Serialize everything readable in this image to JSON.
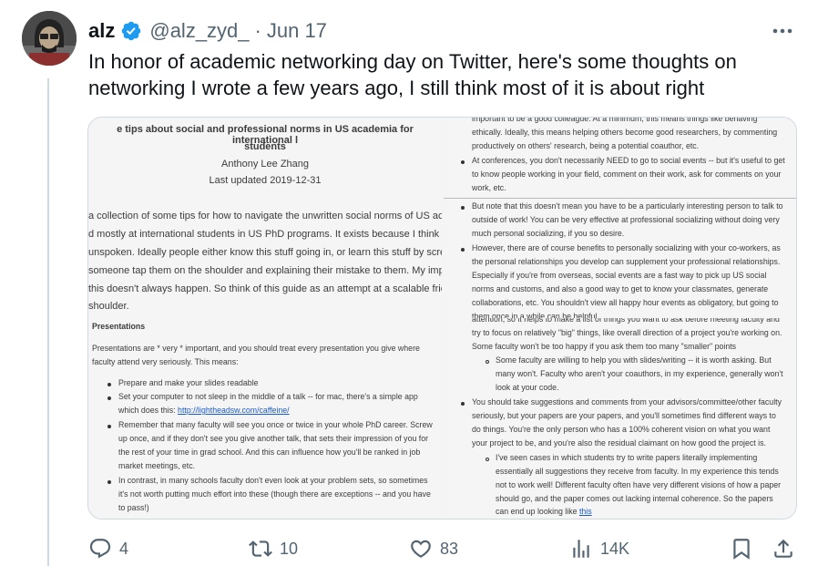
{
  "tweet": {
    "name": "alz",
    "handle": "@alz_zyd_",
    "separator": "·",
    "date": "Jun 17",
    "text": "In honor of academic networking day on Twitter, here's some thoughts on networking I wrote a few years ago, I still think most of it is about right"
  },
  "actions": {
    "replies": "4",
    "retweets": "10",
    "likes": "83",
    "views": "14K"
  },
  "doc": {
    "title_1": "e tips about social and professional norms in US academia for international l",
    "title_2": "students",
    "author": "Anthony Lee Zhang",
    "updated": "Last updated 2019-12-31",
    "intro": [
      "a collection of some tips for how to navigate the unwritten social norms of US acad",
      "d mostly at international students in US PhD programs. It exists because I think a lo",
      "unspoken. Ideally people either know this stuff going in, or learn this stuff by screwi",
      "someone tap them on the shoulder and explaining their mistake to them. My impre",
      "this doesn't always happen. So think of this guide as an attempt at a scalable frienc",
      "shoulder."
    ],
    "section": "Presentations",
    "pres_intro": [
      "Presentations are * very * important, and you should treat every presentation you give where",
      "faculty attend very seriously. This means:"
    ],
    "pres_bullets": [
      [
        "Prepare and make your slides readable"
      ],
      [
        "Set your computer to not sleep in the middle of a talk -- for mac, there's a simple app",
        "which does this: "
      ],
      [
        "Remember that many faculty will see you once or twice in your whole PhD career. Screw",
        "up once, and if they don't see you give another talk, that sets their impression of you for",
        "the rest of your time in grad school. And this can influence how you'll be ranked in job",
        "market meetings, etc."
      ],
      [
        "In contrast, in many schools faculty don't even look at your problem sets, so sometimes",
        "it's not worth putting much effort into these (though there are exceptions -- and you have",
        "to pass!)"
      ]
    ],
    "caffeine_link": "http://lightheadsw.com/caffeine/",
    "colleague_frag": [
      "important to be a good colleague. At a minimum, this means things like behaving",
      "ethically. Ideally, this means helping others become good researchers, by commenting",
      "productively on others' research, being a potential coauthor, etc."
    ],
    "conferences": [
      "At conferences, you don't necessarily NEED to go to social events -- but it's useful to get",
      "to know people working in your field, comment on their work, ask for comments on your",
      "work, etc."
    ],
    "social_1": [
      "But note that this doesn't mean you have to be a particularly interesting person to talk to",
      "outside of work! You can be very effective at professional socializing without doing very",
      "much personal socializing, if you so desire."
    ],
    "social_2": [
      "However, there are of course benefits to personally socializing with your co-workers, as",
      "the personal relationships you develop can supplement your professional relationships.",
      "Especially if you're from overseas, social events are a fast way to pick up US social",
      "norms and customs, and also a good way to get to know your classmates, generate",
      "collaborations, etc. You shouldn't view all happy hour events as obligatory, but going to",
      "them once in a while can be helpful."
    ],
    "faculty_top": [
      "attention, so it helps to make a list of things you want to ask before meeting faculty and",
      "try to focus on relatively \"big\" things, like overall direction of a project you're working on.",
      "Some faculty won't be too happy if you ask them too many \"smaller\" points"
    ],
    "faculty_sub": [
      "Some faculty are willing to help you with slides/writing -- it is worth asking. But",
      "many won't. Faculty who aren't your coauthors, in my experience, generally won't",
      "look at your code."
    ],
    "suggestions": [
      "You should take suggestions and comments from your advisors/committee/other faculty",
      "seriously, but your papers are your papers, and you'll sometimes find different ways to",
      "do things. You're the only person who has a 100% coherent vision on what you want",
      "your project to be, and you're also the residual claimant on how good the project is."
    ],
    "suggestions_sub": [
      "I've seen cases in which students try to write papers literally implementing",
      "essentially all suggestions they receive from faculty. In my experience this tends",
      "not to work well! Different faculty often have very different visions of how a paper",
      "should go, and the paper comes out lacking internal coherence. So the papers",
      "can end up looking like "
    ],
    "this_link": "this"
  },
  "colors": {
    "text": "#0f1419",
    "secondary": "#536471",
    "verified": "#1d9bf0",
    "border": "#cfd9de",
    "link": "#1a5cc7"
  },
  "icons": [
    "verified-badge-icon",
    "more-icon",
    "reply-icon",
    "retweet-icon",
    "like-icon",
    "views-icon",
    "bookmark-icon",
    "share-icon"
  ]
}
